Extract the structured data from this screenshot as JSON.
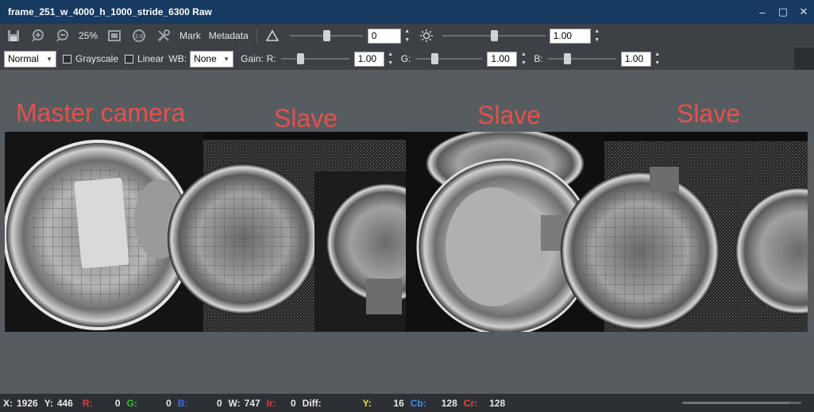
{
  "window": {
    "title": "frame_251_w_4000_h_1000_stride_6300 Raw",
    "controls": {
      "minimize": "–",
      "maximize": "▢",
      "close": "✕"
    }
  },
  "toolbar1": {
    "icons": [
      "save-icon",
      "zoom-in-icon",
      "zoom-out-icon"
    ],
    "zoom_label": "25%",
    "fit_icon": "fit-to-window-icon",
    "actual_size_icon": "actual-size-icon",
    "mark_label": "Mark",
    "metadata_label": "Metadata",
    "contrast": {
      "icon": "contrast-triangle-icon",
      "value": "0",
      "slider_level": 0.5
    },
    "brightness": {
      "icon": "brightness-sun-icon",
      "value": "1.00",
      "slider_level": 0.5
    }
  },
  "toolbar2": {
    "mode": "Normal",
    "grayscale_label": "Grayscale",
    "linear_label": "Linear",
    "wb_label": "WB:",
    "wb_value": "None",
    "gain_label": "Gain:",
    "r_label": "R:",
    "r_value": "1.00",
    "g_label": "G:",
    "g_value": "1.00",
    "b_label": "B:",
    "b_value": "1.00"
  },
  "annotations": {
    "master": "Master camera",
    "slave1": "Slave",
    "slave2": "Slave",
    "slave3": "Slave"
  },
  "status": {
    "x_label": "X:",
    "x": "1926",
    "y_label": "Y:",
    "y": "446",
    "r_label": "R:",
    "r": "0",
    "g_label": "G:",
    "g": "0",
    "b_label": "B:",
    "b": "0",
    "w_label": "W:",
    "w": "747",
    "ir_label": "Ir:",
    "ir": "0",
    "diff_label": "Diff:",
    "yy_label": "Y:",
    "yy": "16",
    "cb_label": "Cb:",
    "cb": "128",
    "cr_label": "Cr:",
    "cr": "128",
    "progress": 0.9
  },
  "colors": {
    "title_bg": "#163a60",
    "annotation_red": "#e3514b",
    "status_r": "#e03a3a",
    "status_g": "#2fc42f",
    "status_b": "#3a6ee8",
    "status_y": "#e8e23a",
    "status_cb": "#3a8ee8",
    "status_cr": "#e04a3a"
  }
}
